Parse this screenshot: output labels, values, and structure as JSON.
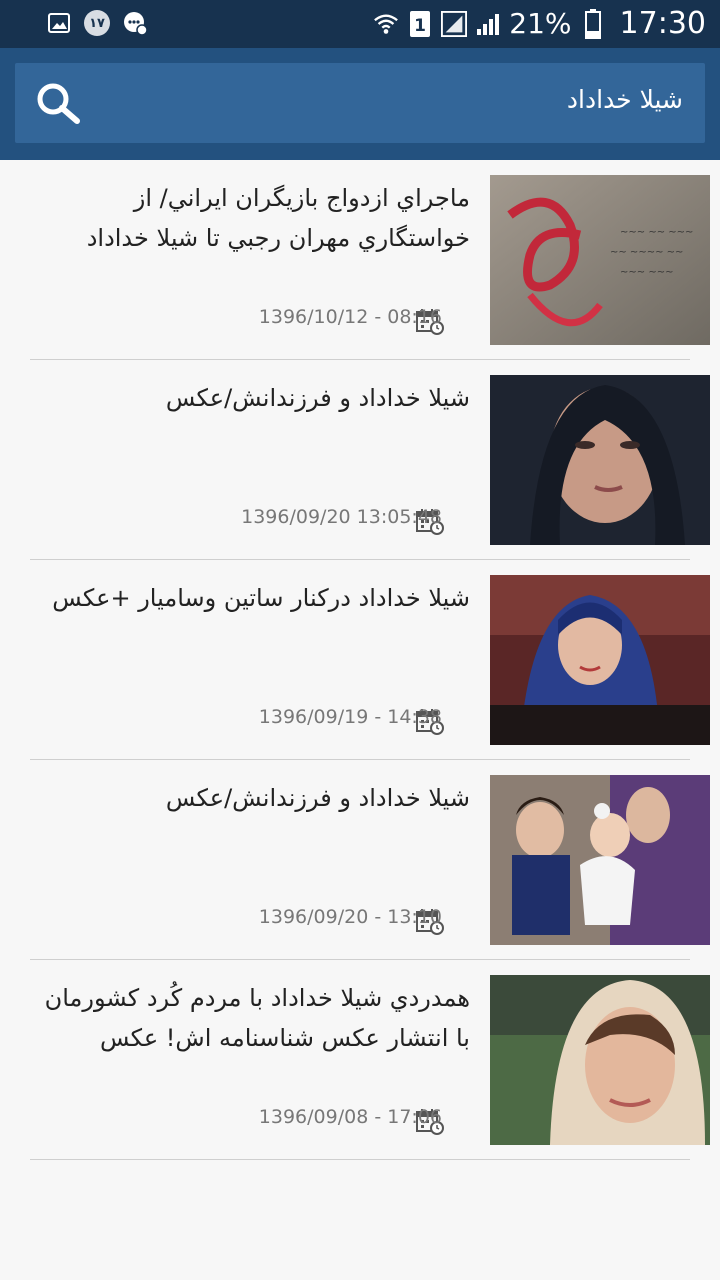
{
  "status_bar": {
    "notification_badge": "۱۷",
    "sim_slot": "1",
    "battery": "21%",
    "time": "17:30"
  },
  "search": {
    "query": "شيلا خداداد"
  },
  "items": [
    {
      "title": "ماجراي ازدواج بازيگران ايراني/ از خواستگاري مهران رجبي تا شيلا خداداد",
      "date": "1396/10/12 - 08:16"
    },
    {
      "title": "شيلا خداداد و فرزندانش/عکس",
      "date": "1396/09/20 13:05:48"
    },
    {
      "title": "شيلا خداداد درکنار ساتين وساميار +عکس",
      "date": "1396/09/19 - 14:38"
    },
    {
      "title": "شيلا خداداد و فرزندانش/عکس",
      "date": "1396/09/20 - 13:10"
    },
    {
      "title": "همدردي شيلا خداداد با مردم کُرد کشورمان با انتشار عکس شناسنامه اش! عکس",
      "date": "1396/09/08 - 17:06"
    }
  ],
  "icons": {
    "search": "search-icon",
    "date": "calendar-clock-icon"
  }
}
